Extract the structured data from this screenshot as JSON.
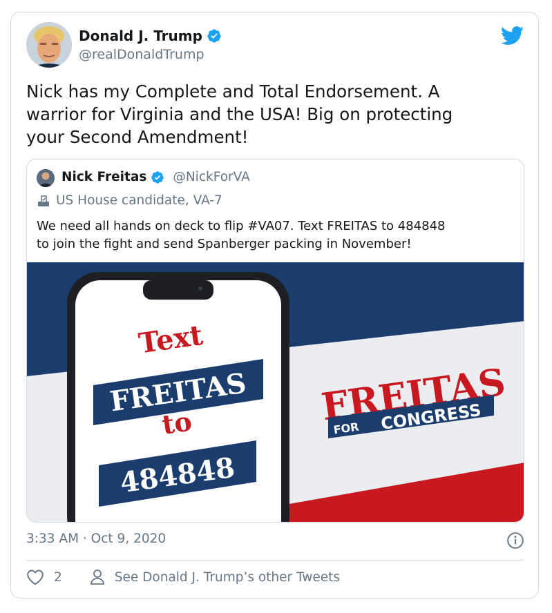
{
  "author": {
    "name": "Donald J. Trump",
    "handle": "@realDonaldTrump",
    "avatar_icon": "trump-avatar",
    "verified_icon": "verified-badge-icon"
  },
  "tweet": {
    "text": "Nick has my Complete and Total Endorsement. A\nwarrior for Virginia and the USA! Big on protecting\nyour Second Amendment!"
  },
  "quoted_tweet": {
    "name": "Nick Freitas",
    "handle": "@NickForVA",
    "label": "US House candidate, VA-7",
    "text": "We need all hands on deck to flip #VA07. Text FREITAS to 484848\nto join the fight and send Spanberger packing in November!",
    "image": {
      "phone_line1": "Text",
      "phone_line2": "FREITAS",
      "phone_line3": "to",
      "phone_line4": "484848",
      "logo_main": "FREITAS",
      "logo_for": "FOR",
      "logo_congress": "CONGRESS"
    }
  },
  "meta": {
    "timestamp": "3:33 AM · Oct 9, 2020",
    "like_count": "2",
    "other_tweets_link": "See Donald J. Trump’s other Tweets"
  },
  "colors": {
    "twitter_blue": "#1da1f2",
    "secondary_text": "#657786",
    "campaign_navy": "#1b3d6e",
    "campaign_red": "#c7191f"
  }
}
